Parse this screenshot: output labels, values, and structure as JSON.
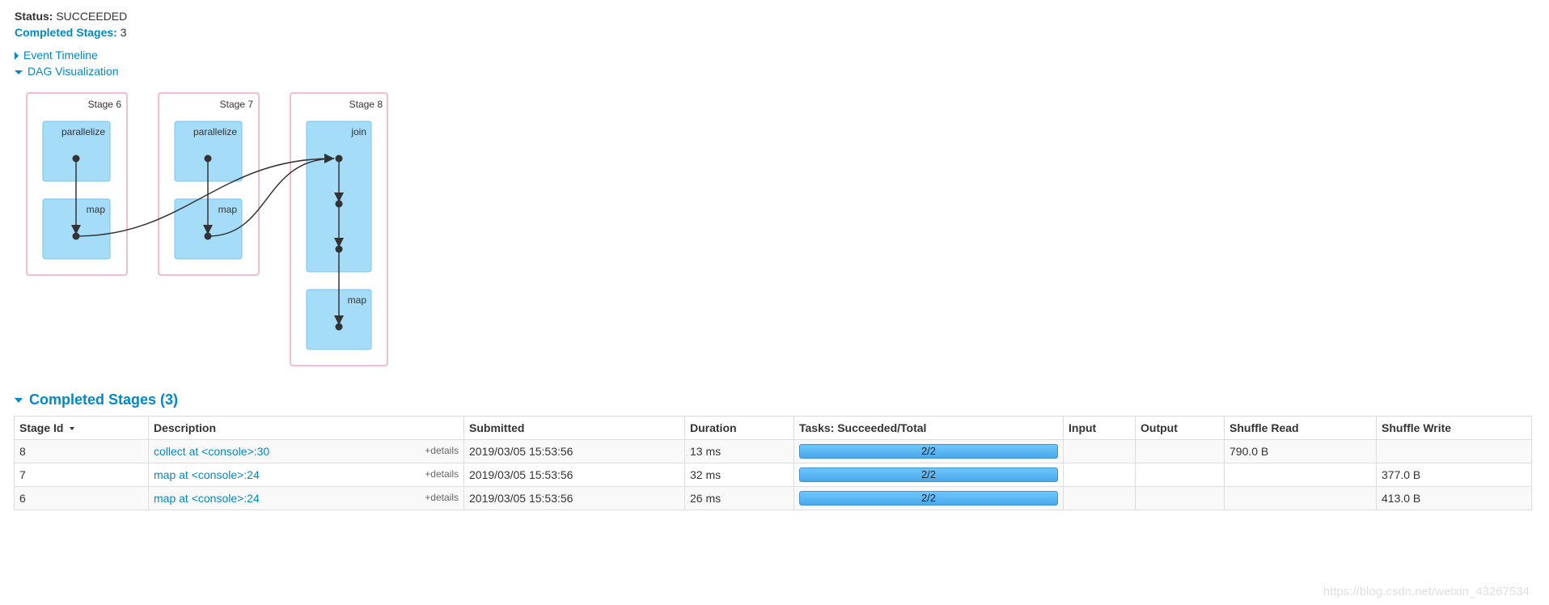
{
  "summary": {
    "status_label": "Status:",
    "status_value": "SUCCEEDED",
    "completed_label": "Completed Stages:",
    "completed_value": "3"
  },
  "toggles": {
    "event_timeline": "Event Timeline",
    "dag_visualization": "DAG Visualization"
  },
  "dag": {
    "stages": [
      {
        "label": "Stage 6",
        "ops": [
          "parallelize",
          "map"
        ]
      },
      {
        "label": "Stage 7",
        "ops": [
          "parallelize",
          "map"
        ]
      },
      {
        "label": "Stage 8",
        "ops": [
          "join",
          "map"
        ]
      }
    ],
    "colors": {
      "stage_border": "#f4a7c0",
      "op_fill": "#a5dcf8",
      "op_border": "#77c5ee",
      "edge": "#333333"
    }
  },
  "completed_section": {
    "title": "Completed Stages (3)"
  },
  "table": {
    "headers": [
      "Stage Id",
      "Description",
      "Submitted",
      "Duration",
      "Tasks: Succeeded/Total",
      "Input",
      "Output",
      "Shuffle Read",
      "Shuffle Write"
    ],
    "details_label": "+details",
    "rows": [
      {
        "id": "8",
        "description": "collect at <console>:30",
        "submitted": "2019/03/05 15:53:56",
        "duration": "13 ms",
        "tasks": "2/2",
        "tasks_done": 1.0,
        "input": "",
        "output": "",
        "shuffle_read": "790.0 B",
        "shuffle_write": ""
      },
      {
        "id": "7",
        "description": "map at <console>:24",
        "submitted": "2019/03/05 15:53:56",
        "duration": "32 ms",
        "tasks": "2/2",
        "tasks_done": 1.0,
        "input": "",
        "output": "",
        "shuffle_read": "",
        "shuffle_write": "377.0 B"
      },
      {
        "id": "6",
        "description": "map at <console>:24",
        "submitted": "2019/03/05 15:53:56",
        "duration": "26 ms",
        "tasks": "2/2",
        "tasks_done": 1.0,
        "input": "",
        "output": "",
        "shuffle_read": "",
        "shuffle_write": "413.0 B"
      }
    ]
  },
  "watermark": "https://blog.csdn.net/weixin_43267534"
}
